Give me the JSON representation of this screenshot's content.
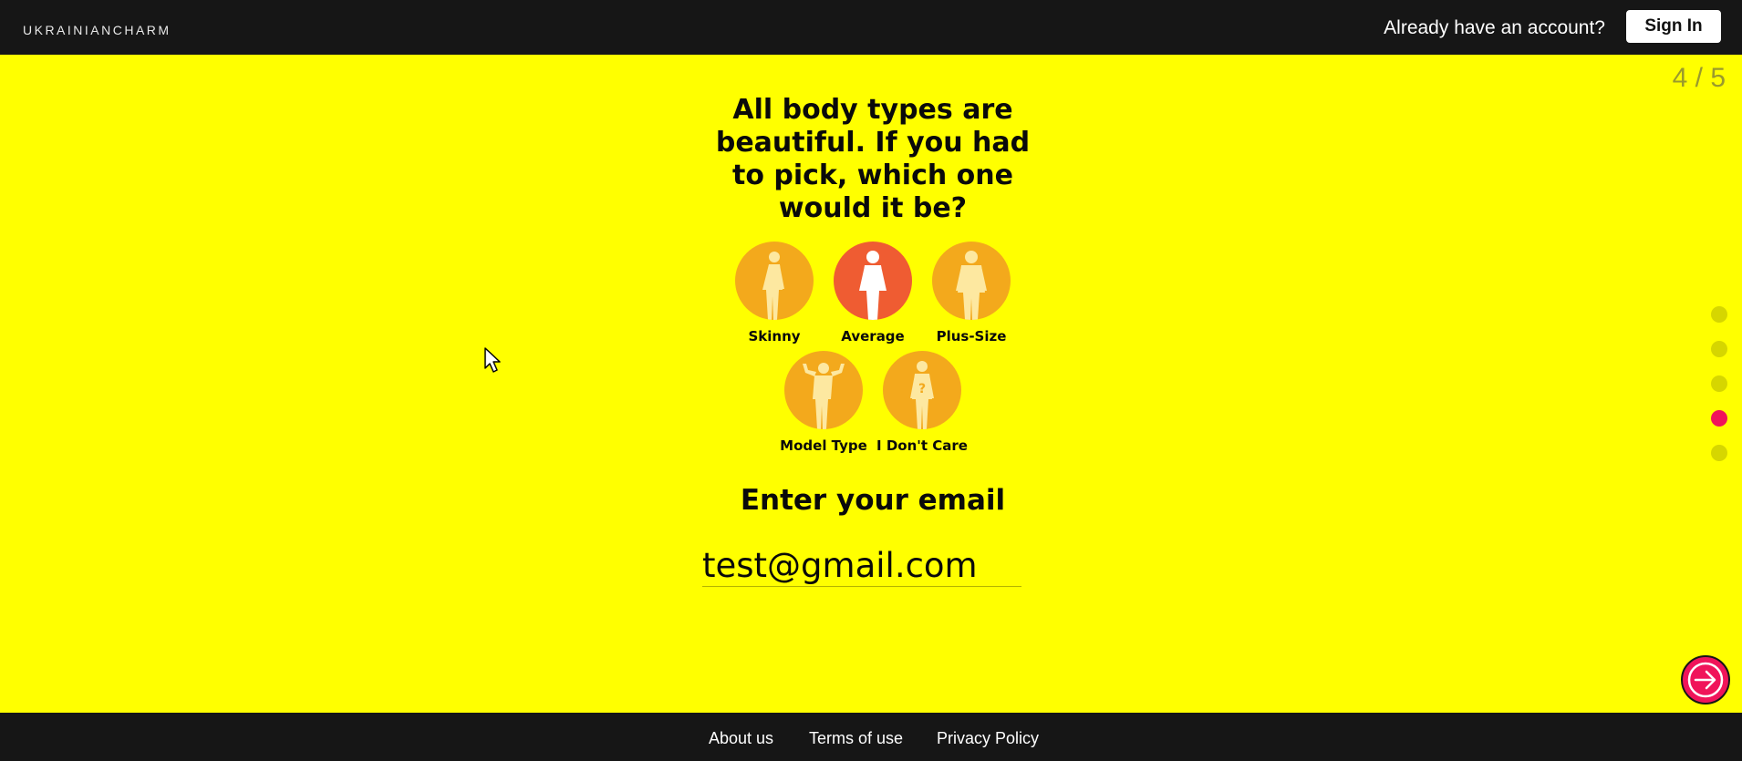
{
  "header": {
    "logo": "UKRAINIANCHARM",
    "account_prompt": "Already have an account?",
    "signin_label": "Sign In"
  },
  "progress": {
    "label": "4 / 5",
    "current": 4,
    "total": 5
  },
  "question": "All body types are beautiful. If you had to pick, which one would it be?",
  "options": [
    {
      "label": "Skinny",
      "icon": "skinny-figure-icon",
      "selected": false
    },
    {
      "label": "Average",
      "icon": "average-figure-icon",
      "selected": true
    },
    {
      "label": "Plus-Size",
      "icon": "plus-size-figure-icon",
      "selected": false
    },
    {
      "label": "Model Type",
      "icon": "model-type-figure-icon",
      "selected": false
    },
    {
      "label": "I Don't Care",
      "icon": "question-figure-icon",
      "selected": false
    }
  ],
  "email": {
    "title": "Enter your email",
    "value": "test@gmail.com"
  },
  "footer": {
    "about": "About us",
    "terms": "Terms of use",
    "privacy": "Privacy Policy"
  },
  "colors": {
    "background": "#ffff00",
    "bar": "#161616",
    "option": "#f3a91c",
    "option_selected": "#ef5c32",
    "accent": "#f0145a"
  }
}
